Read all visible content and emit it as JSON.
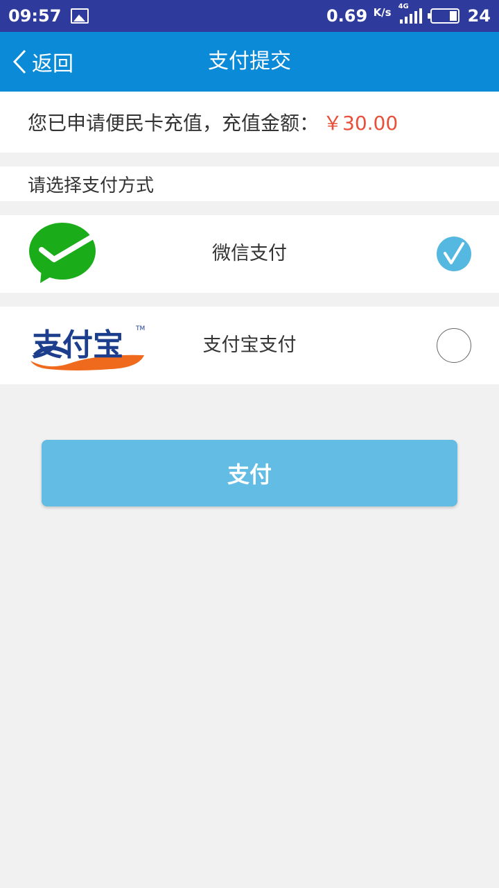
{
  "status_bar": {
    "time": "09:57",
    "speed": "0.69",
    "speed_unit": "K/s",
    "network": "4G",
    "battery": "24",
    "icons": [
      "image-icon",
      "signal-icon",
      "battery-icon"
    ]
  },
  "nav": {
    "back_label": "返回",
    "title": "支付提交",
    "color": "#0b8ad8"
  },
  "order": {
    "text": "您已申请便民卡充值，充值金额：",
    "amount": "￥30.00",
    "amount_color": "#e8503a"
  },
  "payment": {
    "section_label": "请选择支付方式",
    "methods": [
      {
        "label": "微信支付",
        "logo": "wechat-logo-icon",
        "selected": true
      },
      {
        "label": "支付宝支付",
        "logo": "alipay-logo-icon",
        "selected": false
      }
    ],
    "alipay_logo_text": "支付宝",
    "alipay_tm": "TM"
  },
  "submit": {
    "label": "支付",
    "color": "#62bce3"
  }
}
